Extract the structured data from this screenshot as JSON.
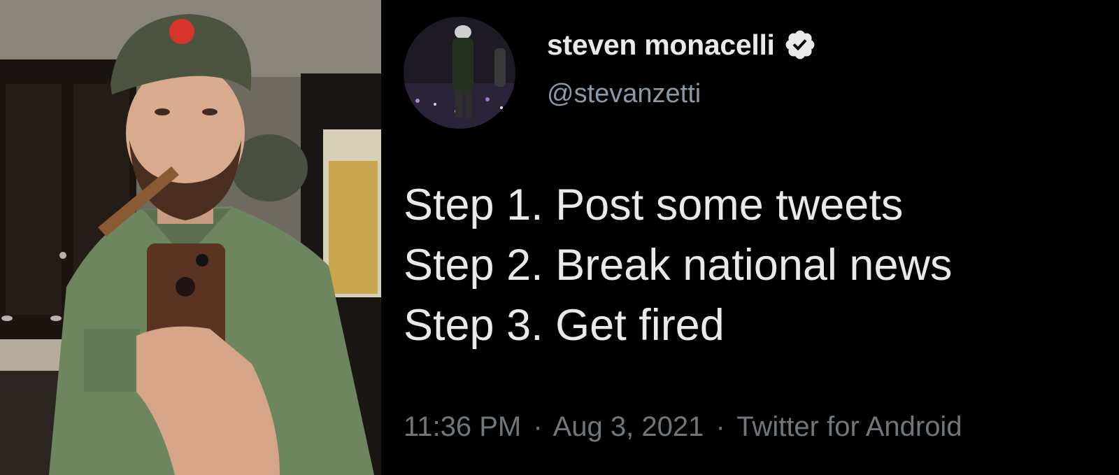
{
  "tweet": {
    "author": {
      "display_name": "steven monacelli",
      "handle": "@stevanzetti",
      "verified": true
    },
    "lines": [
      "Step 1. Post some tweets",
      "Step 2. Break national news",
      "Step 3. Get fired"
    ],
    "meta": {
      "time": "11:36 PM",
      "separator": "·",
      "date": "Aug 3, 2021",
      "source": "Twitter for Android"
    }
  },
  "icons": {
    "verified": "verified-badge-icon"
  },
  "colors": {
    "background": "#000000",
    "text_primary": "#e7e9ea",
    "text_secondary": "#8b98a5",
    "meta_text": "#71767b",
    "verified_badge": "#e7e9ea"
  }
}
